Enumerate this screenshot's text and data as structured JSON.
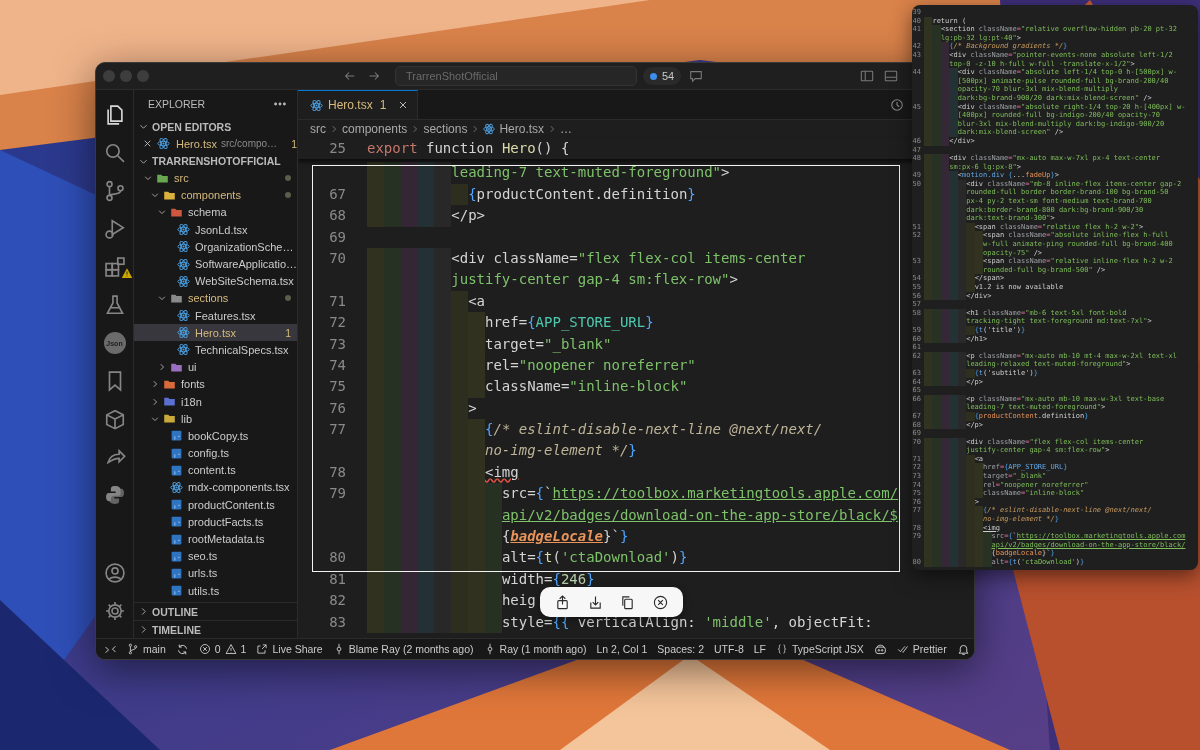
{
  "title_bar": {
    "search_value": "TrarrenShotOfficial",
    "badge_count": "54"
  },
  "activity_bar": {
    "items": [
      {
        "kind": "files",
        "selected": true,
        "warning": false
      },
      {
        "kind": "search",
        "selected": false,
        "warning": false
      },
      {
        "kind": "source-control",
        "selected": false,
        "warning": false
      },
      {
        "kind": "debug",
        "selected": false,
        "warning": false
      },
      {
        "kind": "extensions",
        "selected": false,
        "warning": true
      },
      {
        "kind": "flask",
        "selected": false,
        "warning": false
      },
      {
        "kind": "json",
        "label": "Json",
        "selected": false,
        "warning": false
      },
      {
        "kind": "bookmark",
        "selected": false,
        "warning": false
      },
      {
        "kind": "box",
        "selected": false,
        "warning": false
      },
      {
        "kind": "share",
        "selected": false,
        "warning": false
      },
      {
        "kind": "python",
        "selected": false,
        "warning": false
      }
    ],
    "bottom": [
      {
        "kind": "account"
      },
      {
        "kind": "settings"
      }
    ]
  },
  "explorer": {
    "title": "EXPLORER",
    "open_editors": {
      "title": "OPEN EDITORS",
      "expanded": true,
      "items": [
        {
          "name": "Hero.tsx",
          "path": "src/compo…",
          "problems": "1",
          "kind": "react",
          "modified": true
        }
      ]
    },
    "project": {
      "title": "TRARRENSHOTOFFICIAL",
      "expanded": true,
      "tree": [
        {
          "name": "src",
          "kind": "folder",
          "color": "#6aa84f",
          "expanded": true,
          "selected": false,
          "modified": true,
          "children": [
            {
              "name": "components",
              "kind": "folder",
              "color": "#d9b13b",
              "expanded": true,
              "selected": false,
              "modified": true,
              "children": [
                {
                  "name": "schema",
                  "kind": "folder",
                  "color": "#d0573f",
                  "expanded": true,
                  "selected": false,
                  "modified": false,
                  "children": [
                    {
                      "name": "JsonLd.tsx",
                      "kind": "react",
                      "selected": false,
                      "modified": false
                    },
                    {
                      "name": "OrganizationSche…",
                      "kind": "react",
                      "selected": false,
                      "modified": false
                    },
                    {
                      "name": "SoftwareApplicatio…",
                      "kind": "react",
                      "selected": false,
                      "modified": false
                    },
                    {
                      "name": "WebSiteSchema.tsx",
                      "kind": "react",
                      "selected": false,
                      "modified": false
                    }
                  ]
                },
                {
                  "name": "sections",
                  "kind": "folder",
                  "color": "#8a8a8a",
                  "expanded": true,
                  "selected": false,
                  "modified": true,
                  "children": [
                    {
                      "name": "Features.tsx",
                      "kind": "react",
                      "selected": false,
                      "modified": false
                    },
                    {
                      "name": "Hero.tsx",
                      "kind": "react",
                      "selected": true,
                      "modified": true,
                      "problems": "1"
                    },
                    {
                      "name": "TechnicalSpecs.tsx",
                      "kind": "react",
                      "selected": false,
                      "modified": false
                    }
                  ]
                },
                {
                  "name": "ui",
                  "kind": "folder",
                  "color": "#9a6fc0",
                  "expanded": false,
                  "selected": false,
                  "modified": false
                }
              ]
            },
            {
              "name": "fonts",
              "kind": "folder",
              "color": "#d96b3a",
              "expanded": false,
              "selected": false,
              "modified": false
            },
            {
              "name": "i18n",
              "kind": "folder",
              "color": "#5a6fd0",
              "expanded": false,
              "selected": false,
              "modified": false
            },
            {
              "name": "lib",
              "kind": "folder",
              "color": "#c9a93a",
              "expanded": true,
              "selected": false,
              "modified": false,
              "children": [
                {
                  "name": "bookCopy.ts",
                  "kind": "ts",
                  "selected": false,
                  "modified": false
                },
                {
                  "name": "config.ts",
                  "kind": "ts",
                  "selected": false,
                  "modified": false
                },
                {
                  "name": "content.ts",
                  "kind": "ts",
                  "selected": false,
                  "modified": false
                },
                {
                  "name": "mdx-components.tsx",
                  "kind": "react",
                  "selected": false,
                  "modified": false
                },
                {
                  "name": "productContent.ts",
                  "kind": "ts",
                  "selected": false,
                  "modified": false
                },
                {
                  "name": "productFacts.ts",
                  "kind": "ts",
                  "selected": false,
                  "modified": false
                },
                {
                  "name": "rootMetadata.ts",
                  "kind": "ts",
                  "selected": false,
                  "modified": false
                },
                {
                  "name": "seo.ts",
                  "kind": "ts",
                  "selected": false,
                  "modified": false
                },
                {
                  "name": "urls.ts",
                  "kind": "ts",
                  "selected": false,
                  "modified": false
                },
                {
                  "name": "utils.ts",
                  "kind": "ts",
                  "selected": false,
                  "modified": false
                }
              ]
            }
          ]
        }
      ]
    },
    "outline": {
      "title": "OUTLINE",
      "expanded": false
    },
    "timeline": {
      "title": "TIMELINE",
      "expanded": false
    }
  },
  "editor": {
    "tabs": [
      {
        "label": "Hero.tsx",
        "problems": "1",
        "kind": "react",
        "selected": true
      }
    ],
    "breadcrumb": [
      {
        "text": "src",
        "kind": "folder"
      },
      {
        "text": "components",
        "kind": "folder"
      },
      {
        "text": "sections",
        "kind": "folder"
      },
      {
        "text": "Hero.tsx",
        "kind": "react"
      },
      {
        "text": "…",
        "kind": "symbol"
      }
    ],
    "sticky": {
      "n": "25",
      "code": [
        {
          "kind": "kw",
          "text": "export"
        },
        {
          "kind": "plain",
          "text": " function "
        },
        {
          "kind": "fn",
          "text": "Hero"
        },
        {
          "kind": "plain",
          "text": "() {"
        }
      ]
    },
    "rows": [
      {
        "code": [
          {
            "kind": "str",
            "text": "          leading-7 text-muted-foreground\""
          },
          {
            "kind": "tag",
            "text": ">"
          }
        ]
      },
      {
        "n": "67",
        "code": [
          {
            "kind": "brace",
            "text": "            {"
          },
          {
            "kind": "plain",
            "text": "productContent.definition"
          },
          {
            "kind": "brace",
            "text": "}"
          }
        ]
      },
      {
        "n": "68",
        "code": [
          {
            "kind": "tag",
            "text": "          </p>"
          }
        ]
      },
      {
        "n": "69"
      },
      {
        "n": "70",
        "code": [
          {
            "kind": "tag",
            "text": "          <div"
          },
          {
            "kind": "attr",
            "text": " className"
          },
          {
            "kind": "eq",
            "text": "="
          },
          {
            "kind": "str",
            "text": "\"flex flex-col items-center"
          }
        ]
      },
      {
        "code": [
          {
            "kind": "str",
            "text": "          justify-center gap-4 sm:flex-row\""
          },
          {
            "kind": "tag",
            "text": ">"
          }
        ]
      },
      {
        "n": "71",
        "code": [
          {
            "kind": "tag",
            "text": "            <a"
          }
        ]
      },
      {
        "n": "72",
        "code": [
          {
            "kind": "attr",
            "text": "              href"
          },
          {
            "kind": "eq",
            "text": "="
          },
          {
            "kind": "brace",
            "text": "{"
          },
          {
            "kind": "const",
            "text": "APP_STORE_URL"
          },
          {
            "kind": "brace",
            "text": "}"
          }
        ]
      },
      {
        "n": "73",
        "code": [
          {
            "kind": "attr",
            "text": "              target"
          },
          {
            "kind": "eq",
            "text": "="
          },
          {
            "kind": "str",
            "text": "\"_blank\""
          }
        ]
      },
      {
        "n": "74",
        "code": [
          {
            "kind": "attr",
            "text": "              rel"
          },
          {
            "kind": "eq",
            "text": "="
          },
          {
            "kind": "str",
            "text": "\"noopener noreferrer\""
          }
        ]
      },
      {
        "n": "75",
        "code": [
          {
            "kind": "attr",
            "text": "              className"
          },
          {
            "kind": "eq",
            "text": "="
          },
          {
            "kind": "str",
            "text": "\"inline-block\""
          }
        ]
      },
      {
        "n": "76",
        "code": [
          {
            "kind": "tag",
            "text": "            >"
          }
        ]
      },
      {
        "n": "77",
        "code": [
          {
            "kind": "brace",
            "text": "              {"
          },
          {
            "kind": "comment",
            "text": "/* eslint-disable-next-line @next/next/"
          }
        ]
      },
      {
        "code": [
          {
            "kind": "comment",
            "text": "              no-img-element */"
          },
          {
            "kind": "brace",
            "text": "}"
          }
        ]
      },
      {
        "n": "78",
        "code": [
          {
            "kind": "err",
            "text": "              <img"
          }
        ]
      },
      {
        "n": "79",
        "code": [
          {
            "kind": "attr",
            "text": "                src"
          },
          {
            "kind": "eq",
            "text": "="
          },
          {
            "kind": "brace",
            "text": "{"
          },
          {
            "kind": "plain",
            "text": "`"
          },
          {
            "kind": "link",
            "text": "https://toolbox.marketingtools.apple.com/"
          }
        ]
      },
      {
        "code": [
          {
            "kind": "link",
            "text": "                api/v2/badges/download-on-the-app-store/black/$"
          }
        ]
      },
      {
        "code": [
          {
            "kind": "plain",
            "text": "                {"
          },
          {
            "kind": "var",
            "text": "badgeLocale"
          },
          {
            "kind": "plain",
            "text": "}`"
          },
          {
            "kind": "brace",
            "text": "}"
          }
        ]
      },
      {
        "n": "80",
        "code": [
          {
            "kind": "attr",
            "text": "                alt"
          },
          {
            "kind": "eq",
            "text": "="
          },
          {
            "kind": "brace",
            "text": "{"
          },
          {
            "kind": "fn",
            "text": "t"
          },
          {
            "kind": "plain",
            "text": "("
          },
          {
            "kind": "str",
            "text": "'ctaDownload'"
          },
          {
            "kind": "plain",
            "text": ")"
          },
          {
            "kind": "brace",
            "text": "}"
          }
        ]
      },
      {
        "n": "81",
        "code": [
          {
            "kind": "attr",
            "text": "                width"
          },
          {
            "kind": "eq",
            "text": "="
          },
          {
            "kind": "brace",
            "text": "{"
          },
          {
            "kind": "num",
            "text": "246"
          },
          {
            "kind": "brace",
            "text": "}"
          }
        ]
      },
      {
        "n": "82",
        "code": [
          {
            "kind": "attr",
            "text": "                heig"
          }
        ]
      },
      {
        "n": "83",
        "code": [
          {
            "kind": "attr",
            "text": "                style"
          },
          {
            "kind": "eq",
            "text": "="
          },
          {
            "kind": "brace",
            "text": "{{"
          },
          {
            "kind": "plain",
            "text": " verticalAlign: "
          },
          {
            "kind": "str",
            "text": "'middle'"
          },
          {
            "kind": "plain",
            "text": ", objectFit:"
          }
        ]
      }
    ]
  },
  "capture_toolbar": {
    "actions": [
      {
        "kind": "share"
      },
      {
        "kind": "save"
      },
      {
        "kind": "copy"
      },
      {
        "kind": "close"
      }
    ]
  },
  "status_bar": {
    "items": [
      {
        "kind": "remote"
      },
      {
        "kind": "branch",
        "text": "main"
      },
      {
        "kind": "sync"
      },
      {
        "kind": "problems",
        "errors": "0",
        "warnings": "1"
      },
      {
        "kind": "live-share",
        "text": "Live Share"
      },
      {
        "kind": "blame",
        "text": "Blame Ray (2 months ago)"
      },
      {
        "kind": "commit",
        "text": "Ray (1 month ago)"
      },
      {
        "kind": "text",
        "text": "Ln 2, Col 1"
      },
      {
        "kind": "text",
        "text": "Spaces: 2"
      },
      {
        "kind": "text",
        "text": "UTF-8"
      },
      {
        "kind": "text",
        "text": "LF"
      },
      {
        "kind": "language",
        "text": "TypeScript JSX"
      },
      {
        "kind": "copilot"
      },
      {
        "kind": "prettier",
        "text": "Prettier"
      },
      {
        "kind": "bell"
      }
    ]
  },
  "peek_panel": {
    "rows": [
      {
        "n": "39"
      },
      {
        "n": "40",
        "code": [
          {
            "kind": "plain",
            "text": "  return ("
          }
        ]
      },
      {
        "n": "41",
        "code": [
          {
            "kind": "tag",
            "text": "    <section"
          },
          {
            "kind": "attr",
            "text": " className"
          },
          {
            "kind": "eq",
            "text": "="
          },
          {
            "kind": "str",
            "text": "\"relative overflow-hidden pb-20 pt-32"
          }
        ]
      },
      {
        "code": [
          {
            "kind": "str",
            "text": "    lg:pb-32 lg:pt-40\""
          },
          {
            "kind": "tag",
            "text": ">"
          }
        ]
      },
      {
        "n": "42",
        "code": [
          {
            "kind": "brace",
            "text": "      {"
          },
          {
            "kind": "comment",
            "text": "/* Background gradients */"
          },
          {
            "kind": "brace",
            "text": "}"
          }
        ]
      },
      {
        "n": "43",
        "code": [
          {
            "kind": "tag",
            "text": "      <div"
          },
          {
            "kind": "attr",
            "text": " className"
          },
          {
            "kind": "eq",
            "text": "="
          },
          {
            "kind": "str",
            "text": "\"pointer-events-none absolute left-1/2"
          }
        ]
      },
      {
        "code": [
          {
            "kind": "str",
            "text": "      top-0 -z-10 h-full w-full -translate-x-1/2\""
          },
          {
            "kind": "tag",
            "text": ">"
          }
        ]
      },
      {
        "n": "44",
        "code": [
          {
            "kind": "tag",
            "text": "        <div"
          },
          {
            "kind": "attr",
            "text": " className"
          },
          {
            "kind": "eq",
            "text": "="
          },
          {
            "kind": "str",
            "text": "\"absolute left-1/4 top-0 h-[500px] w-"
          }
        ]
      },
      {
        "code": [
          {
            "kind": "str",
            "text": "        [500px] animate-pulse rounded-full bg-brand-200/40"
          }
        ]
      },
      {
        "code": [
          {
            "kind": "str",
            "text": "        opacity-70 blur-3xl mix-blend-multiply"
          }
        ]
      },
      {
        "code": [
          {
            "kind": "str",
            "text": "        dark:bg-brand-900/20 dark:mix-blend-screen\""
          },
          {
            "kind": "tag",
            "text": " />"
          }
        ]
      },
      {
        "n": "45",
        "code": [
          {
            "kind": "tag",
            "text": "        <div"
          },
          {
            "kind": "attr",
            "text": " className"
          },
          {
            "kind": "eq",
            "text": "="
          },
          {
            "kind": "str",
            "text": "\"absolute right-1/4 top-20 h-[400px] w-"
          }
        ]
      },
      {
        "code": [
          {
            "kind": "str",
            "text": "        [400px] rounded-full bg-indigo-200/40 opacity-70"
          }
        ]
      },
      {
        "code": [
          {
            "kind": "str",
            "text": "        blur-3xl mix-blend-multiply dark:bg-indigo-900/20"
          }
        ]
      },
      {
        "code": [
          {
            "kind": "str",
            "text": "        dark:mix-blend-screen\""
          },
          {
            "kind": "tag",
            "text": " />"
          }
        ]
      },
      {
        "n": "46",
        "code": [
          {
            "kind": "tag",
            "text": "      </div>"
          }
        ]
      },
      {
        "n": "47"
      },
      {
        "n": "48",
        "code": [
          {
            "kind": "tag",
            "text": "      <div"
          },
          {
            "kind": "attr",
            "text": " className"
          },
          {
            "kind": "eq",
            "text": "="
          },
          {
            "kind": "str",
            "text": "\"mx-auto max-w-7xl px-4 text-center"
          }
        ]
      },
      {
        "code": [
          {
            "kind": "str",
            "text": "      sm:px-6 lg:px-8\""
          },
          {
            "kind": "tag",
            "text": ">"
          }
        ]
      },
      {
        "n": "49",
        "code": [
          {
            "kind": "tag",
            "text": "        <"
          },
          {
            "kind": "fn",
            "text": "motion.div"
          },
          {
            "kind": "brace",
            "text": " {"
          },
          {
            "kind": "plain",
            "text": "..."
          },
          {
            "kind": "var",
            "text": "fadeUp"
          },
          {
            "kind": "brace",
            "text": "}"
          },
          {
            "kind": "tag",
            "text": ">"
          }
        ]
      },
      {
        "n": "50",
        "code": [
          {
            "kind": "tag",
            "text": "          <div"
          },
          {
            "kind": "attr",
            "text": " className"
          },
          {
            "kind": "eq",
            "text": "="
          },
          {
            "kind": "str",
            "text": "\"mb-8 inline-flex items-center gap-2"
          }
        ]
      },
      {
        "code": [
          {
            "kind": "str",
            "text": "          rounded-full border border-brand-100 bg-brand-50"
          }
        ]
      },
      {
        "code": [
          {
            "kind": "str",
            "text": "          px-4 py-2 text-sm font-medium text-brand-700"
          }
        ]
      },
      {
        "code": [
          {
            "kind": "str",
            "text": "          dark:border-brand-800 dark:bg-brand-900/30"
          }
        ]
      },
      {
        "code": [
          {
            "kind": "str",
            "text": "          dark:text-brand-300\""
          },
          {
            "kind": "tag",
            "text": ">"
          }
        ]
      },
      {
        "n": "51",
        "code": [
          {
            "kind": "tag",
            "text": "            <span"
          },
          {
            "kind": "attr",
            "text": " className"
          },
          {
            "kind": "eq",
            "text": "="
          },
          {
            "kind": "str",
            "text": "\"relative flex h-2 w-2\""
          },
          {
            "kind": "tag",
            "text": ">"
          }
        ]
      },
      {
        "n": "52",
        "code": [
          {
            "kind": "tag",
            "text": "              <span"
          },
          {
            "kind": "attr",
            "text": " className"
          },
          {
            "kind": "eq",
            "text": "="
          },
          {
            "kind": "str",
            "text": "\"absolute inline-flex h-full"
          }
        ]
      },
      {
        "code": [
          {
            "kind": "str",
            "text": "              w-full animate-ping rounded-full bg-brand-400"
          }
        ]
      },
      {
        "code": [
          {
            "kind": "str",
            "text": "              opacity-75\""
          },
          {
            "kind": "tag",
            "text": " />"
          }
        ]
      },
      {
        "n": "53",
        "code": [
          {
            "kind": "tag",
            "text": "              <span"
          },
          {
            "kind": "attr",
            "text": " className"
          },
          {
            "kind": "eq",
            "text": "="
          },
          {
            "kind": "str",
            "text": "\"relative inline-flex h-2 w-2"
          }
        ]
      },
      {
        "code": [
          {
            "kind": "str",
            "text": "              rounded-full bg-brand-500\""
          },
          {
            "kind": "tag",
            "text": " />"
          }
        ]
      },
      {
        "n": "54",
        "code": [
          {
            "kind": "tag",
            "text": "            </span>"
          }
        ]
      },
      {
        "n": "55",
        "code": [
          {
            "kind": "plain",
            "text": "            v1.2 is now available"
          }
        ]
      },
      {
        "n": "56",
        "code": [
          {
            "kind": "tag",
            "text": "          </div>"
          }
        ]
      },
      {
        "n": "57"
      },
      {
        "n": "58",
        "code": [
          {
            "kind": "tag",
            "text": "          <h1"
          },
          {
            "kind": "attr",
            "text": " className"
          },
          {
            "kind": "eq",
            "text": "="
          },
          {
            "kind": "str",
            "text": "\"mb-6 text-5xl font-bold"
          }
        ]
      },
      {
        "code": [
          {
            "kind": "str",
            "text": "          tracking-tight text-foreground md:text-7xl\""
          },
          {
            "kind": "tag",
            "text": ">"
          }
        ]
      },
      {
        "n": "59",
        "code": [
          {
            "kind": "brace",
            "text": "            {"
          },
          {
            "kind": "fn",
            "text": "t"
          },
          {
            "kind": "plain",
            "text": "('title')"
          },
          {
            "kind": "brace",
            "text": "}"
          }
        ]
      },
      {
        "n": "60",
        "code": [
          {
            "kind": "tag",
            "text": "          </h1>"
          }
        ]
      },
      {
        "n": "61"
      },
      {
        "n": "62",
        "code": [
          {
            "kind": "tag",
            "text": "          <p"
          },
          {
            "kind": "attr",
            "text": " className"
          },
          {
            "kind": "eq",
            "text": "="
          },
          {
            "kind": "str",
            "text": "\"mx-auto mb-10 mt-4 max-w-2xl text-xl"
          }
        ]
      },
      {
        "code": [
          {
            "kind": "str",
            "text": "          leading-relaxed text-muted-foreground\""
          },
          {
            "kind": "tag",
            "text": ">"
          }
        ]
      },
      {
        "n": "63",
        "code": [
          {
            "kind": "brace",
            "text": "            {"
          },
          {
            "kind": "fn",
            "text": "t"
          },
          {
            "kind": "plain",
            "text": "('subtitle')"
          },
          {
            "kind": "brace",
            "text": "}"
          }
        ]
      },
      {
        "n": "64",
        "code": [
          {
            "kind": "tag",
            "text": "          </p>"
          }
        ]
      },
      {
        "n": "65"
      },
      {
        "n": "66",
        "code": [
          {
            "kind": "tag",
            "text": "          <p"
          },
          {
            "kind": "attr",
            "text": " className"
          },
          {
            "kind": "eq",
            "text": "="
          },
          {
            "kind": "str",
            "text": "\"mx-auto mb-10 max-w-3xl text-base"
          }
        ]
      },
      {
        "code": [
          {
            "kind": "str",
            "text": "          leading-7 text-muted-foreground\""
          },
          {
            "kind": "tag",
            "text": ">"
          }
        ]
      },
      {
        "n": "67",
        "code": [
          {
            "kind": "brace",
            "text": "            {"
          },
          {
            "kind": "var",
            "text": "productContent"
          },
          {
            "kind": "plain",
            "text": ".definition"
          },
          {
            "kind": "brace",
            "text": "}"
          }
        ]
      },
      {
        "n": "68",
        "code": [
          {
            "kind": "tag",
            "text": "          </p>"
          }
        ]
      },
      {
        "n": "69"
      },
      {
        "n": "70",
        "code": [
          {
            "kind": "tag",
            "text": "          <div"
          },
          {
            "kind": "attr",
            "text": " className"
          },
          {
            "kind": "eq",
            "text": "="
          },
          {
            "kind": "str",
            "text": "\"flex flex-col items-center"
          }
        ]
      },
      {
        "code": [
          {
            "kind": "str",
            "text": "          justify-center gap-4 sm:flex-row\""
          },
          {
            "kind": "tag",
            "text": ">"
          }
        ]
      },
      {
        "n": "71",
        "code": [
          {
            "kind": "tag",
            "text": "            <a"
          }
        ]
      },
      {
        "n": "72",
        "code": [
          {
            "kind": "attr",
            "text": "              href"
          },
          {
            "kind": "eq",
            "text": "="
          },
          {
            "kind": "brace",
            "text": "{"
          },
          {
            "kind": "const",
            "text": "APP_STORE_URL"
          },
          {
            "kind": "brace",
            "text": "}"
          }
        ]
      },
      {
        "n": "73",
        "code": [
          {
            "kind": "attr",
            "text": "              target"
          },
          {
            "kind": "eq",
            "text": "="
          },
          {
            "kind": "str",
            "text": "\"_blank\""
          }
        ]
      },
      {
        "n": "74",
        "code": [
          {
            "kind": "attr",
            "text": "              rel"
          },
          {
            "kind": "eq",
            "text": "="
          },
          {
            "kind": "str",
            "text": "\"noopener noreferrer\""
          }
        ]
      },
      {
        "n": "75",
        "code": [
          {
            "kind": "attr",
            "text": "              className"
          },
          {
            "kind": "eq",
            "text": "="
          },
          {
            "kind": "str",
            "text": "\"inline-block\""
          }
        ]
      },
      {
        "n": "76",
        "code": [
          {
            "kind": "tag",
            "text": "            >"
          }
        ]
      },
      {
        "n": "77",
        "code": [
          {
            "kind": "brace",
            "text": "              {"
          },
          {
            "kind": "comment",
            "text": "/* eslint-disable-next-line @next/next/"
          }
        ]
      },
      {
        "code": [
          {
            "kind": "comment",
            "text": "              no-img-element */"
          },
          {
            "kind": "brace",
            "text": "}"
          }
        ]
      },
      {
        "n": "78",
        "code": [
          {
            "kind": "err",
            "text": "              <img"
          }
        ]
      },
      {
        "n": "79",
        "code": [
          {
            "kind": "attr",
            "text": "                src"
          },
          {
            "kind": "eq",
            "text": "="
          },
          {
            "kind": "brace",
            "text": "{"
          },
          {
            "kind": "plain",
            "text": "`"
          },
          {
            "kind": "link",
            "text": "https://toolbox.marketingtools.apple.com"
          }
        ]
      },
      {
        "code": [
          {
            "kind": "link",
            "text": "                api/v2/badges/download-on-the-app-store/black/"
          }
        ]
      },
      {
        "code": [
          {
            "kind": "plain",
            "text": "                {"
          },
          {
            "kind": "var",
            "text": "badgeLocale"
          },
          {
            "kind": "plain",
            "text": "}`"
          },
          {
            "kind": "brace",
            "text": "}"
          }
        ]
      },
      {
        "n": "80",
        "code": [
          {
            "kind": "attr",
            "text": "                alt"
          },
          {
            "kind": "eq",
            "text": "="
          },
          {
            "kind": "brace",
            "text": "{"
          },
          {
            "kind": "fn",
            "text": "t"
          },
          {
            "kind": "plain",
            "text": "("
          },
          {
            "kind": "str",
            "text": "'ctaDownload'"
          },
          {
            "kind": "plain",
            "text": ")"
          },
          {
            "kind": "brace",
            "text": "}"
          }
        ]
      }
    ]
  }
}
